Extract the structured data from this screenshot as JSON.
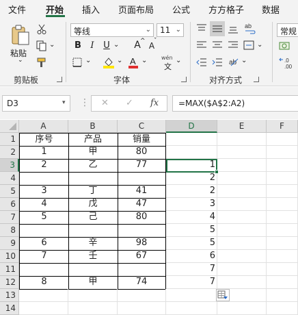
{
  "menu": {
    "tabs": [
      "文件",
      "开始",
      "插入",
      "页面布局",
      "公式",
      "方方格子",
      "数据"
    ],
    "active": "开始"
  },
  "ribbon": {
    "clipboard": {
      "label": "剪贴板",
      "paste": "粘贴"
    },
    "font": {
      "label": "字体",
      "family": "等线",
      "size": "11",
      "bold": "B",
      "italic": "I",
      "underline": "U",
      "grow": "A",
      "shrink": "A",
      "phonetic": "wén"
    },
    "alignment": {
      "label": "对齐方式"
    },
    "number": {
      "format": "常规"
    }
  },
  "formula_bar": {
    "name_box": "D3",
    "fx": "fx",
    "formula": "=MAX($A$2:A2)"
  },
  "sheet": {
    "columns": [
      "A",
      "B",
      "C",
      "D",
      "E",
      "F"
    ],
    "rows": [
      "1",
      "2",
      "3",
      "4",
      "5",
      "6",
      "7",
      "8",
      "9",
      "10",
      "11",
      "12",
      "13",
      "14"
    ],
    "selected_col": "D",
    "selected_row": "3",
    "table": [
      [
        "序号",
        "产品",
        "销量"
      ],
      [
        "1",
        "甲",
        "80"
      ],
      [
        "2",
        "乙",
        "77"
      ],
      [
        "",
        "",
        ""
      ],
      [
        "3",
        "丁",
        "41"
      ],
      [
        "4",
        "戊",
        "47"
      ],
      [
        "5",
        "己",
        "80"
      ],
      [
        "",
        "",
        ""
      ],
      [
        "6",
        "辛",
        "98"
      ],
      [
        "7",
        "壬",
        "67"
      ],
      [
        "",
        "",
        ""
      ],
      [
        "8",
        "甲",
        "74"
      ]
    ],
    "col_d": [
      "",
      "",
      "1",
      "2",
      "2",
      "3",
      "4",
      "5",
      "5",
      "6",
      "7",
      "7",
      "",
      ""
    ]
  },
  "colors": {
    "accent": "#217346",
    "font_color": "#e03030",
    "highlight": "#ffe600"
  }
}
